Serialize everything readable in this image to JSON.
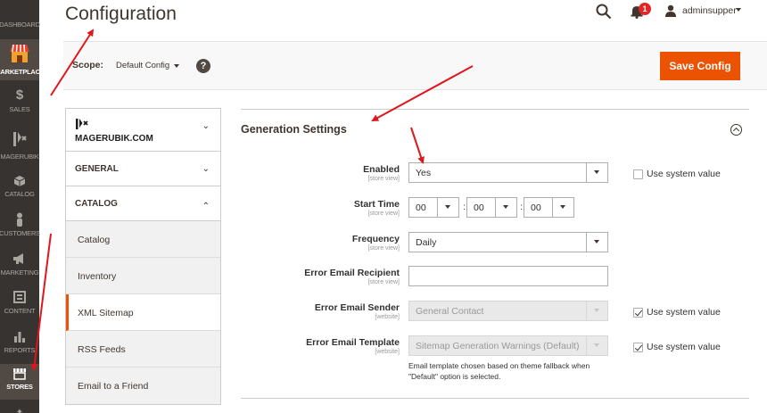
{
  "header": {
    "title": "Configuration",
    "notification_count": "1",
    "user_name": "adminsupper"
  },
  "nav": {
    "items": [
      {
        "label": "Dashboard",
        "icon": "dashboard-icon"
      },
      {
        "label": "Marketplace",
        "icon": "marketplace-icon"
      },
      {
        "label": "Sales",
        "icon": "sales-icon"
      },
      {
        "label": "Magerubik",
        "icon": "magerubik-icon"
      },
      {
        "label": "Catalog",
        "icon": "catalog-icon"
      },
      {
        "label": "Customers",
        "icon": "customers-icon"
      },
      {
        "label": "Marketing",
        "icon": "marketing-icon"
      },
      {
        "label": "Content",
        "icon": "content-icon"
      },
      {
        "label": "Reports",
        "icon": "reports-icon"
      },
      {
        "label": "Stores",
        "icon": "stores-icon"
      }
    ]
  },
  "scope": {
    "label": "Scope:",
    "value": "Default Config"
  },
  "save_button": "Save Config",
  "tabs": {
    "vendor": "MAGERUBIK.COM",
    "general": "GENERAL",
    "catalog": "CATALOG",
    "items": [
      "Catalog",
      "Inventory",
      "XML Sitemap",
      "RSS Feeds",
      "Email to a Friend"
    ],
    "active_item": "XML Sitemap"
  },
  "section": {
    "title": "Generation Settings",
    "fields": {
      "enabled": {
        "label": "Enabled",
        "scope": "[store view]",
        "value": "Yes",
        "use_system_value": false
      },
      "start_time": {
        "label": "Start Time",
        "scope": "[store view]",
        "hour": "00",
        "minute": "00",
        "second": "00",
        "sep": ":"
      },
      "frequency": {
        "label": "Frequency",
        "scope": "[store view]",
        "value": "Daily"
      },
      "error_email_recipient": {
        "label": "Error Email Recipient",
        "scope": "[store view]",
        "value": ""
      },
      "error_email_sender": {
        "label": "Error Email Sender",
        "scope": "[website]",
        "value": "General Contact",
        "use_system_value": true
      },
      "error_email_template": {
        "label": "Error Email Template",
        "scope": "[website]",
        "value": "Sitemap Generation Warnings (Default)",
        "use_system_value": true,
        "note": "Email template chosen based on theme fallback when \"Default\" option is selected."
      }
    },
    "use_system_value_label": "Use system value"
  },
  "colors": {
    "nav_bg": "#373330",
    "accent": "#eb5202",
    "annotation": "#e0161a"
  }
}
